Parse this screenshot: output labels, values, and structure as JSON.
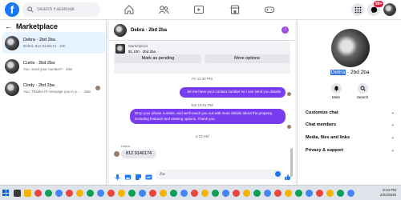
{
  "topbar": {
    "logo": "f",
    "search_placeholder": "Search Facebook",
    "nav_icons": [
      "home-icon",
      "friends-icon",
      "video-icon",
      "marketplace-icon",
      "gaming-icon"
    ],
    "notification_badge": "99+"
  },
  "sidebar": {
    "title": "Marketplace",
    "conversations": [
      {
        "name": "Debra · 2bd 2ba",
        "preview": "Debra: 812 9146174 · 10h",
        "active": true
      },
      {
        "name": "Curtis · 2bd 2ba",
        "preview": "You: send your number? · 19w",
        "active": false
      },
      {
        "name": "Cindy · 2bd 2ba",
        "preview": "You: Thanks I'll message you in a ... · 19w",
        "active": false
      }
    ]
  },
  "chat": {
    "title": "Debra · 2bd 2ba",
    "listing_category": "Marketplace",
    "listing_price": "$1,100 · 2bd 2ba",
    "mark_pending": "Mark as pending",
    "more_options": "More options",
    "messages": [
      {
        "type": "timestamp",
        "text": "Fri 11:40 PM"
      },
      {
        "type": "out",
        "text": "...let me have your contact number so i can send you details"
      },
      {
        "type": "timestamp",
        "text": "Sat 10:51 PM"
      },
      {
        "type": "out",
        "text": "Drop your phone number, and we'll reach you out with more details about the property, including features and viewing options.  Thank you"
      },
      {
        "type": "timestamp",
        "text": "4:23 AM"
      },
      {
        "type": "in",
        "sender": "Debra",
        "text": "812 9146174"
      }
    ],
    "composer_placeholder": "Aa"
  },
  "info_panel": {
    "name_highlight": "Debra",
    "name_rest": " · 2bd 2ba",
    "mute": "Mute",
    "search": "Search",
    "menu": [
      "Customize chat",
      "Chat members",
      "Media, files and links",
      "Privacy & support"
    ]
  },
  "taskbar": {
    "time": "8:34 PM",
    "date": "2/22/2025"
  }
}
